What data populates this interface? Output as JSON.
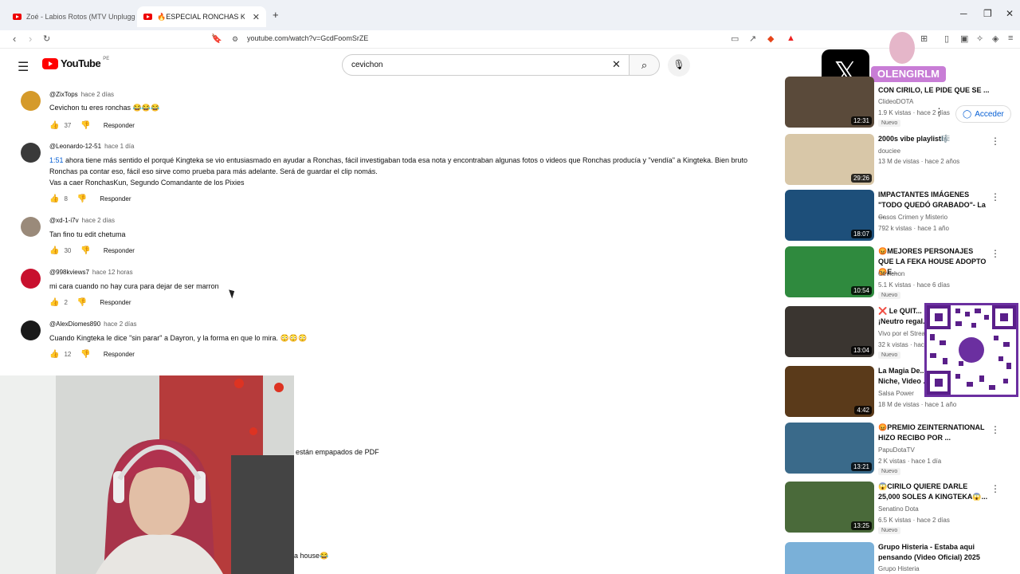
{
  "browser": {
    "tabs": [
      {
        "title": "Zoé - Labios Rotos (MTV Unplugged)"
      },
      {
        "title": "🔥ESPECIAL RONCHAS KUN🔥"
      }
    ],
    "new_tab": "+",
    "url": "youtube.com/watch?v=GcdFoomSrZE"
  },
  "youtube": {
    "logo_text": "YouTube",
    "region": "PE",
    "search_value": "cevichon",
    "signin": "Acceder"
  },
  "overlay": {
    "x_handle": "OLENGIRLM"
  },
  "comments": [
    {
      "author": "@ZixTops",
      "time": "hace 2 días",
      "text": "Cevichon tu eres ronchas 😂😂😂",
      "likes": "37",
      "reply": "Responder",
      "avatar_color": "#d59a2a"
    },
    {
      "author": "@Leonardo-12-51",
      "time": "hace 1 día",
      "timestamp": "1:51",
      "text": " ahora tiene más sentido el porqué Kingteka se vio entusiasmado en ayudar a Ronchas, fácil investigaban toda esa nota y encontraban algunas fotos o videos que Ronchas producía y \"vendía\" a Kingteka. Bien bruto Ronchas pa contar eso, fácil eso sirve como prueba para más adelante. Será de guardar el clip nomás.",
      "text2": "Vas a caer RonchasKun, Segundo Comandante de los Pixies",
      "likes": "8",
      "reply": "Responder",
      "avatar_color": "#3a3a3a"
    },
    {
      "author": "@xd-1-i7v",
      "time": "hace 2 días",
      "text": "Tan fino tu edit chetuma",
      "likes": "30",
      "reply": "Responder",
      "avatar_color": "#9a8a7a"
    },
    {
      "author": "@998kviews7",
      "time": "hace 12 horas",
      "text": "mi cara cuando no hay cura para dejar de ser marron",
      "likes": "2",
      "reply": "Responder",
      "avatar_color": "#c8102e"
    },
    {
      "author": "@AlexDiomes890",
      "time": "hace 2 días",
      "text": "Cuando Kingteka le dice \"sin parar\" a Dayron, y la forma en que lo mira. 😳😳😳",
      "likes": "12",
      "reply": "Responder",
      "avatar_color": "#1a1a1a"
    }
  ],
  "peek_texts": {
    "line1": "están empapados de PDF",
    "line2": "a house😂"
  },
  "videos": [
    {
      "title": "CON CIRILO, LE PIDE QUE SE ...",
      "channel": "ClideoDOTA",
      "meta": "1.9 K vistas · hace 2 días",
      "badge": "Nuevo",
      "duration": "12:31",
      "thumb": "#5a4a3a"
    },
    {
      "title": "2000s vibe playlist🎼",
      "channel": "douciee",
      "meta": "13 M de vistas · hace 2 años",
      "badge": "",
      "duration": "29:26",
      "thumb": "#d8c7a8"
    },
    {
      "title": "IMPACTANTES IMÁGENES \"TODO QUEDÓ GRABADO\"- La ...",
      "channel": "Casos Crimen y Misterio",
      "meta": "792 k vistas · hace 1 año",
      "badge": "",
      "duration": "18:07",
      "thumb": "#1d4f7a"
    },
    {
      "title": "😡MEJORES PERSONAJES QUE LA FEKA HOUSE ADOPTO😡E...",
      "channel": "Cevichon",
      "meta": "5.1 K vistas · hace 6 días",
      "badge": "Nuevo",
      "duration": "10:54",
      "thumb": "#2f8a3e"
    },
    {
      "title": "❌ Le QUIT...",
      "title2": "¡Neutro regal...",
      "channel": "Vivo por el Strea...",
      "meta": "32 k vistas · hace...",
      "badge": "Nuevo",
      "duration": "13:04",
      "thumb": "#3a3530"
    },
    {
      "title": "La Magia De...",
      "title2": "Niche, Video ...",
      "channel": "Salsa Power",
      "meta": "18 M de vistas · hace 1 año",
      "badge": "",
      "duration": "4:42",
      "thumb": "#5a3a1a"
    },
    {
      "title": "😡PREMIO ZEINTERNATIONAL HIZO RECIBO POR ...",
      "channel": "PapuDotaTV",
      "meta": "2 K vistas · hace 1 día",
      "badge": "Nuevo",
      "duration": "13:21",
      "thumb": "#3a6a8a"
    },
    {
      "title": "😱CIRILO QUIERE DARLE 25,000 SOLES A KINGTEKA😱...",
      "channel": "Senatino Dota",
      "meta": "6.5 K vistas · hace 2 días",
      "badge": "Nuevo",
      "duration": "13:25",
      "thumb": "#4a6a3a"
    },
    {
      "title": "Grupo Histeria - Estaba aqui pensando (Video Oficial) 2025",
      "channel": "Grupo Histeria",
      "meta": "",
      "badge": "",
      "duration": "",
      "thumb": "#7ab0d8"
    }
  ]
}
